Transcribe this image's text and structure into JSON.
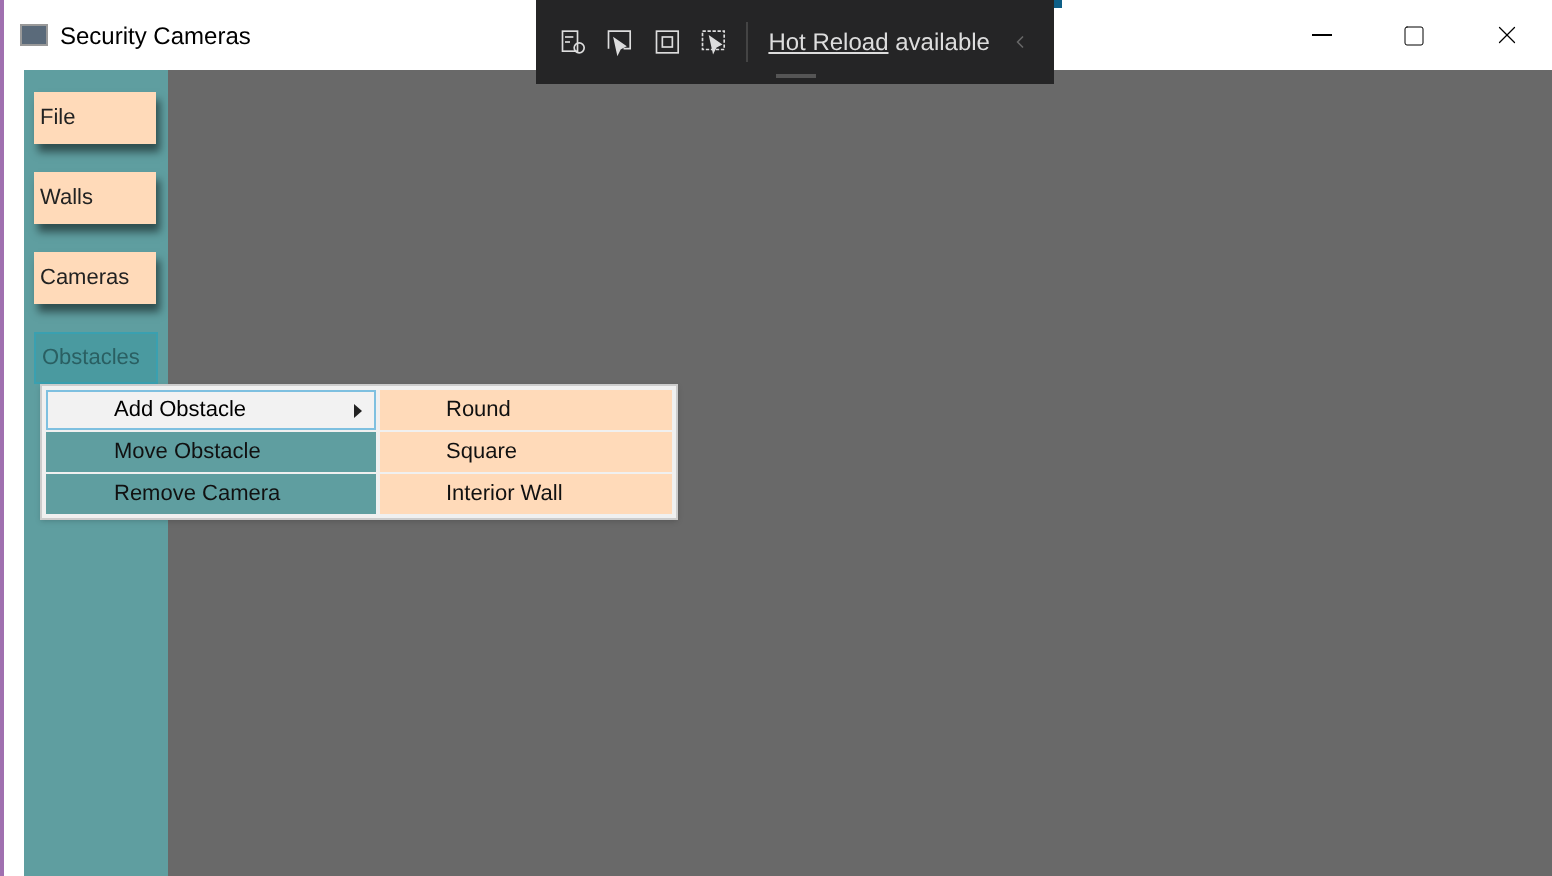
{
  "window": {
    "title": "Security Cameras"
  },
  "hot_reload": {
    "link": "Hot Reload",
    "text": "available"
  },
  "sidebar": {
    "items": [
      {
        "label": "File",
        "selected": false
      },
      {
        "label": "Walls",
        "selected": false
      },
      {
        "label": "Cameras",
        "selected": false
      },
      {
        "label": "Obstacles",
        "selected": true
      }
    ]
  },
  "context_menu": {
    "items": [
      {
        "label": "Add Obstacle",
        "selected": true,
        "has_submenu": true
      },
      {
        "label": "Move Obstacle",
        "selected": false,
        "has_submenu": false
      },
      {
        "label": "Remove Camera",
        "selected": false,
        "has_submenu": false
      }
    ]
  },
  "submenu": {
    "items": [
      {
        "label": "Round"
      },
      {
        "label": "Square"
      },
      {
        "label": "Interior Wall"
      }
    ]
  }
}
